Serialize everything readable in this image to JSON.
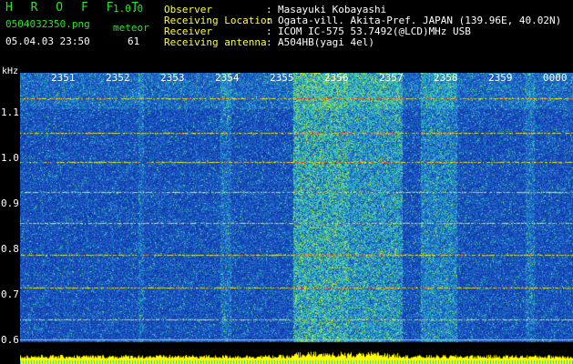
{
  "app": {
    "title": "H R O F F T",
    "version": "1.0.0"
  },
  "file": {
    "name": "0504032350.png",
    "timestamp": "05.04.03 23:50"
  },
  "event": {
    "type": "meteor",
    "count": "61"
  },
  "info": [
    {
      "key": "Observer",
      "value": "Masayuki Kobayashi"
    },
    {
      "key": "Receiving Location",
      "value": "Ogata-vill. Akita-Pref. JAPAN (139.96E, 40.02N)"
    },
    {
      "key": "Receiver",
      "value": "ICOM IC-575 53.7492(@LCD)MHz USB"
    },
    {
      "key": "Receiving antenna",
      "value": "A504HB(yagi 4el)"
    }
  ],
  "separator": ":",
  "chart_data": {
    "type": "heatmap",
    "ylabel": "kHz",
    "y_ticks": [
      "1.1",
      "1.0",
      "0.9",
      "0.8",
      "0.7",
      "0.6"
    ],
    "x_ticks": [
      "2351",
      "2352",
      "2353",
      "2354",
      "2355",
      "2356",
      "2357",
      "2358",
      "2359",
      "0000"
    ],
    "colormap": [
      "#000070",
      "#0a2aa0",
      "#1e5ac8",
      "#28c8c8",
      "#b4e628",
      "#ffff00",
      "#ff2828"
    ],
    "baseline_color": "#ffff00"
  }
}
